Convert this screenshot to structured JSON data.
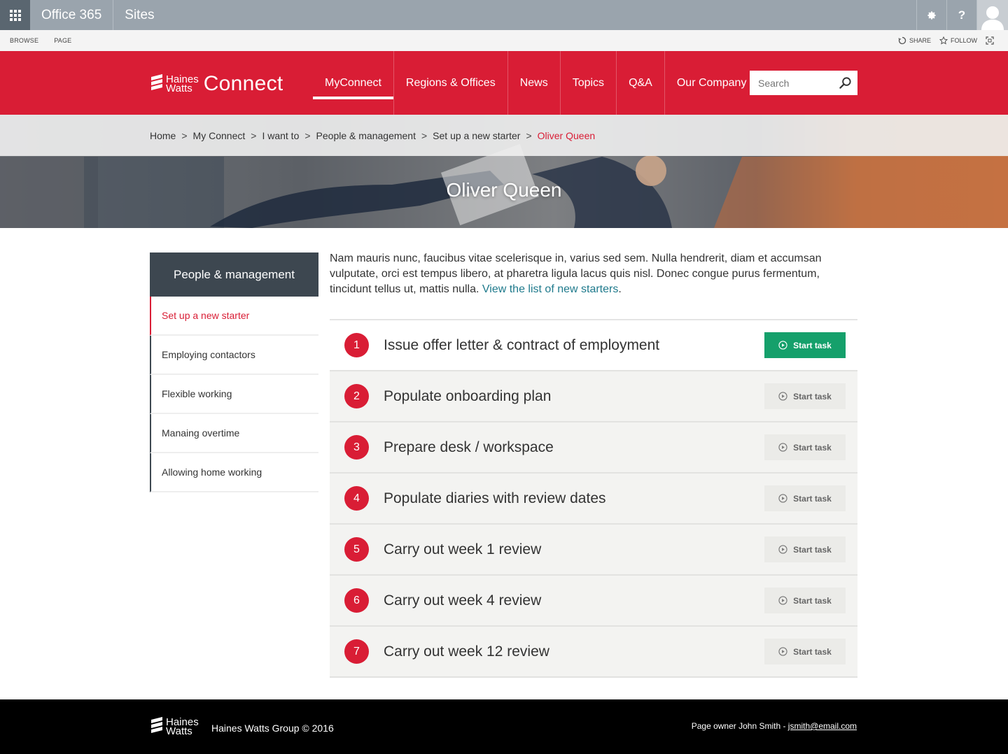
{
  "suite_bar": {
    "app_name": "Office 365",
    "section": "Sites",
    "settings_icon": "gear-icon",
    "help_label": "?",
    "avatar_icon": "user-avatar-icon"
  },
  "ribbon": {
    "tabs": [
      "BROWSE",
      "PAGE"
    ],
    "share_label": "SHARE",
    "follow_label": "FOLLOW"
  },
  "brand": {
    "logo_line1": "Haines",
    "logo_line2": "Watts",
    "product": "Connect",
    "accent_color": "#d91d35"
  },
  "nav": {
    "items": [
      "MyConnect",
      "Regions & Offices",
      "News",
      "Topics",
      "Q&A",
      "Our Company"
    ],
    "active_index": 0
  },
  "search": {
    "placeholder": "Search"
  },
  "breadcrumb": {
    "items": [
      "Home",
      "My Connect",
      "I want to",
      "People & management",
      "Set up a new starter"
    ],
    "current": "Oliver Queen",
    "separator": ">"
  },
  "banner": {
    "title": "Oliver Queen"
  },
  "sidebar": {
    "heading": "People & management",
    "items": [
      "Set up a new starter",
      "Employing contactors",
      "Flexible working",
      "Manaing overtime",
      "Allowing home working"
    ],
    "active_index": 0
  },
  "intro": {
    "text": "Nam mauris nunc, faucibus vitae scelerisque in, varius sed sem. Nulla hendrerit, diam et accumsan vulputate, orci est tempus libero, at pharetra ligula lacus quis nisl. Donec congue purus fermentum, tincidunt tellus ut, mattis nulla. ",
    "link_text": "View the list of new starters",
    "trailing": "."
  },
  "tasks": {
    "button_label": "Start task",
    "items": [
      {
        "number": "1",
        "label": "Issue offer letter & contract of employment"
      },
      {
        "number": "2",
        "label": "Populate onboarding plan"
      },
      {
        "number": "3",
        "label": "Prepare desk / workspace"
      },
      {
        "number": "4",
        "label": "Populate diaries with review dates"
      },
      {
        "number": "5",
        "label": "Carry out week 1 review"
      },
      {
        "number": "6",
        "label": "Carry out week 4 review"
      },
      {
        "number": "7",
        "label": "Carry out week 12 review"
      }
    ],
    "primary_color": "#15a06b"
  },
  "footer": {
    "logo_line1": "Haines",
    "logo_line2": "Watts",
    "copyright": "Haines Watts Group © 2016",
    "owner_prefix": "Page owner John Smith - ",
    "owner_email": "jsmith@email.com"
  }
}
